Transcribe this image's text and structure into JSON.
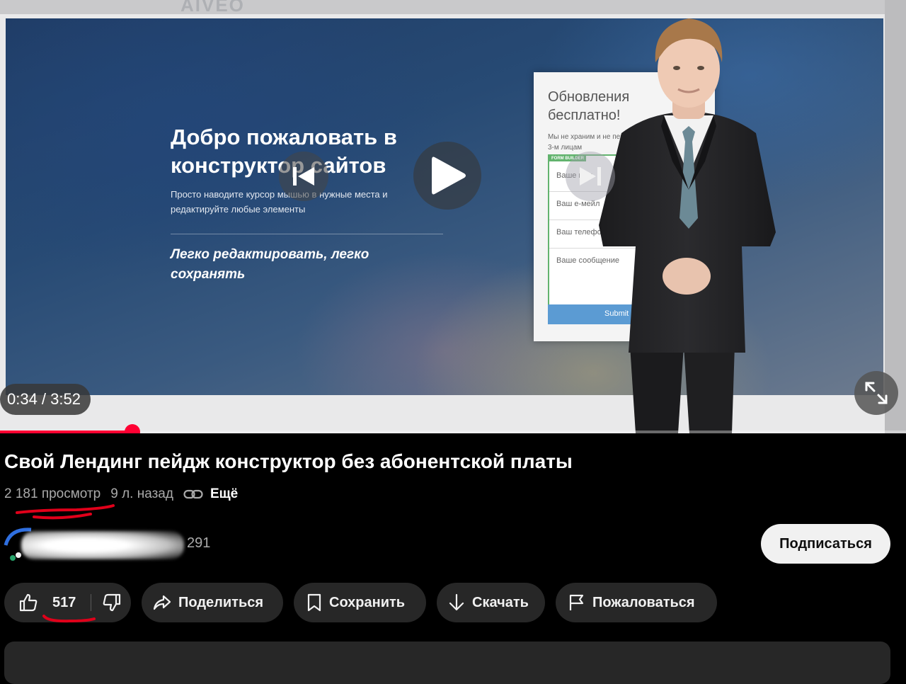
{
  "player": {
    "site_logo": "AIVEO",
    "hero": {
      "title": "Добро пожаловать в конструктор сайтов",
      "subtitle": "Просто наводите курсор мышью в нужные места и редактируйте любые элементы",
      "tagline": "Легко редактировать, легко сохранять"
    },
    "form": {
      "heading": "Обновления бесплатно!",
      "note": "Мы не храним и не передаем ваши данные 3-м лицам",
      "badge": "FORM BUILDER",
      "fields": [
        "Ваше имя",
        "Ваш e-мейл",
        "Ваш телефон",
        "Ваше сообщение"
      ],
      "submit_label": "Submit"
    },
    "time_display": "0:34 / 3:52",
    "progress": 0.146
  },
  "video": {
    "title": "Свой Лендинг пейдж конструктор без абонентской платы",
    "views": "2 181 просмотр",
    "age": "9 л. назад",
    "more_label": "Ещё"
  },
  "channel": {
    "subscribers": "291",
    "subscribe_label": "Подписаться"
  },
  "actions": {
    "likes": "517",
    "share_label": "Поделиться",
    "save_label": "Сохранить",
    "download_label": "Скачать",
    "report_label": "Пожаловаться"
  },
  "colors": {
    "accent": "#ff0033",
    "annotation_ink": "#e0001a",
    "pill_bg": "#272727",
    "page_bg": "#000000"
  }
}
